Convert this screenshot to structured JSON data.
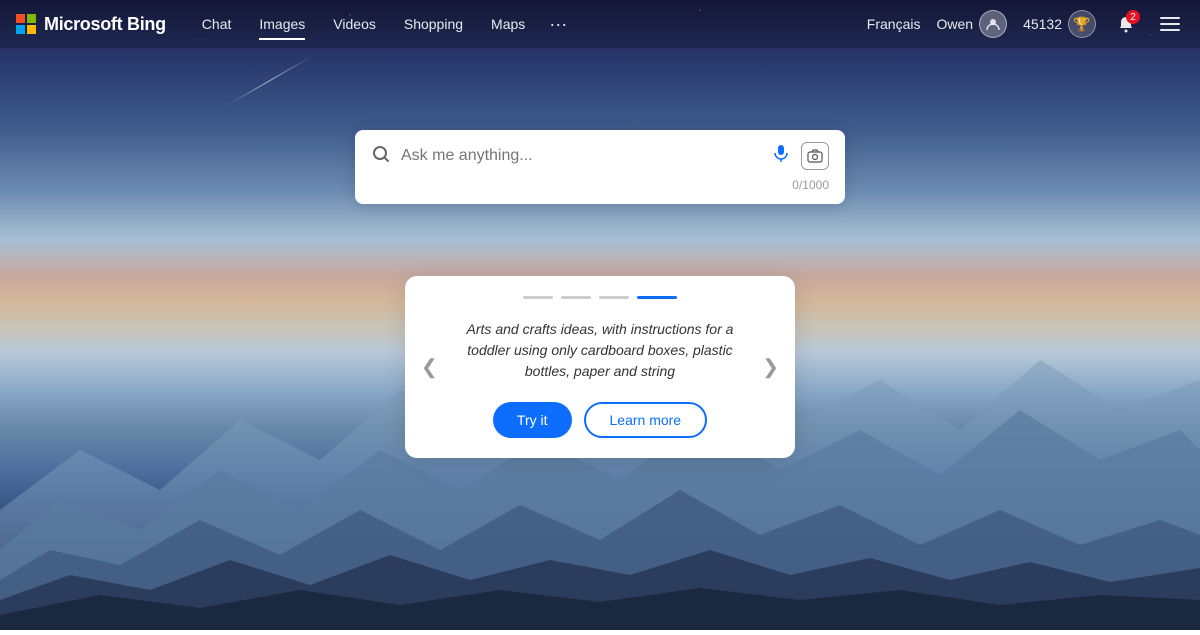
{
  "brand": {
    "name": "Microsoft Bing"
  },
  "nav": {
    "items": [
      {
        "label": "Chat",
        "active": false
      },
      {
        "label": "Images",
        "active": true
      },
      {
        "label": "Videos",
        "active": false
      },
      {
        "label": "Shopping",
        "active": false
      },
      {
        "label": "Maps",
        "active": false
      }
    ],
    "more_label": "···"
  },
  "navbar_right": {
    "lang": "Français",
    "user_name": "Owen",
    "points": "45132",
    "notif_count": "2"
  },
  "search": {
    "placeholder": "Ask me anything...",
    "counter": "0/1000"
  },
  "suggestion_card": {
    "dots": [
      {
        "active": false
      },
      {
        "active": false
      },
      {
        "active": false
      },
      {
        "active": true
      }
    ],
    "text": "Arts and crafts ideas, with instructions for a toddler using only cardboard boxes, plastic bottles, paper and string",
    "try_label": "Try it",
    "learn_label": "Learn more",
    "prev_arrow": "❮",
    "next_arrow": "❯"
  }
}
